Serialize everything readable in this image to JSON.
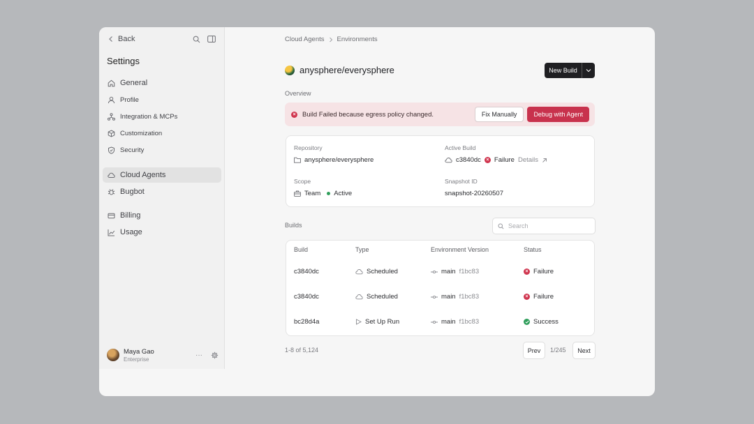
{
  "sidebar": {
    "back_label": "Back",
    "title": "Settings",
    "items": [
      {
        "label": "General"
      },
      {
        "label": "Profile"
      },
      {
        "label": "Integration & MCPs"
      },
      {
        "label": "Customization"
      },
      {
        "label": "Security"
      },
      {
        "label": "Cloud Agents"
      },
      {
        "label": "Bugbot"
      },
      {
        "label": "Billing"
      },
      {
        "label": "Usage"
      }
    ],
    "active_item": "Cloud Agents",
    "user": {
      "name": "Maya Gao",
      "plan": "Enterprise",
      "more": "···"
    }
  },
  "main": {
    "breadcrumb": [
      "Cloud Agents",
      "Environments"
    ],
    "repo": "anysphere/everysphere",
    "new_build_label": "New Build",
    "overview_label": "Overview",
    "alert": {
      "text": "Build Failed because egress policy changed.",
      "fix_label": "Fix Manually",
      "debug_label": "Debug with Agent"
    },
    "overview": {
      "repository_label": "Repository",
      "repository_value": "anysphere/everysphere",
      "active_build_label": "Active Build",
      "active_build_commit": "c3840dc",
      "active_build_status": "Failure",
      "details_label": "Details",
      "scope_label": "Scope",
      "scope_value": "Team",
      "scope_status": "Active",
      "snapshot_label": "Snapshot ID",
      "snapshot_value": "snapshot-20260507"
    },
    "builds_label": "Builds",
    "search_placeholder": "Search",
    "table": {
      "headers": [
        "Build",
        "Type",
        "Environment Version",
        "Status"
      ],
      "rows": [
        {
          "build": "c3840dc",
          "type": "Scheduled",
          "branch": "main",
          "commit": "f1bc83",
          "status": "Failure"
        },
        {
          "build": "c3840dc",
          "type": "Scheduled",
          "branch": "main",
          "commit": "f1bc83",
          "status": "Failure"
        },
        {
          "build": "bc28d4a",
          "type": "Set Up Run",
          "branch": "main",
          "commit": "f1bc83",
          "status": "Success"
        }
      ]
    },
    "pagination": {
      "info": "1-8 of 5,124",
      "prev": "Prev",
      "page": "1/245",
      "next": "Next"
    }
  },
  "colors": {
    "danger": "#c8324d",
    "success": "#2f9e5b",
    "alert_bg": "#f6e3e5"
  }
}
